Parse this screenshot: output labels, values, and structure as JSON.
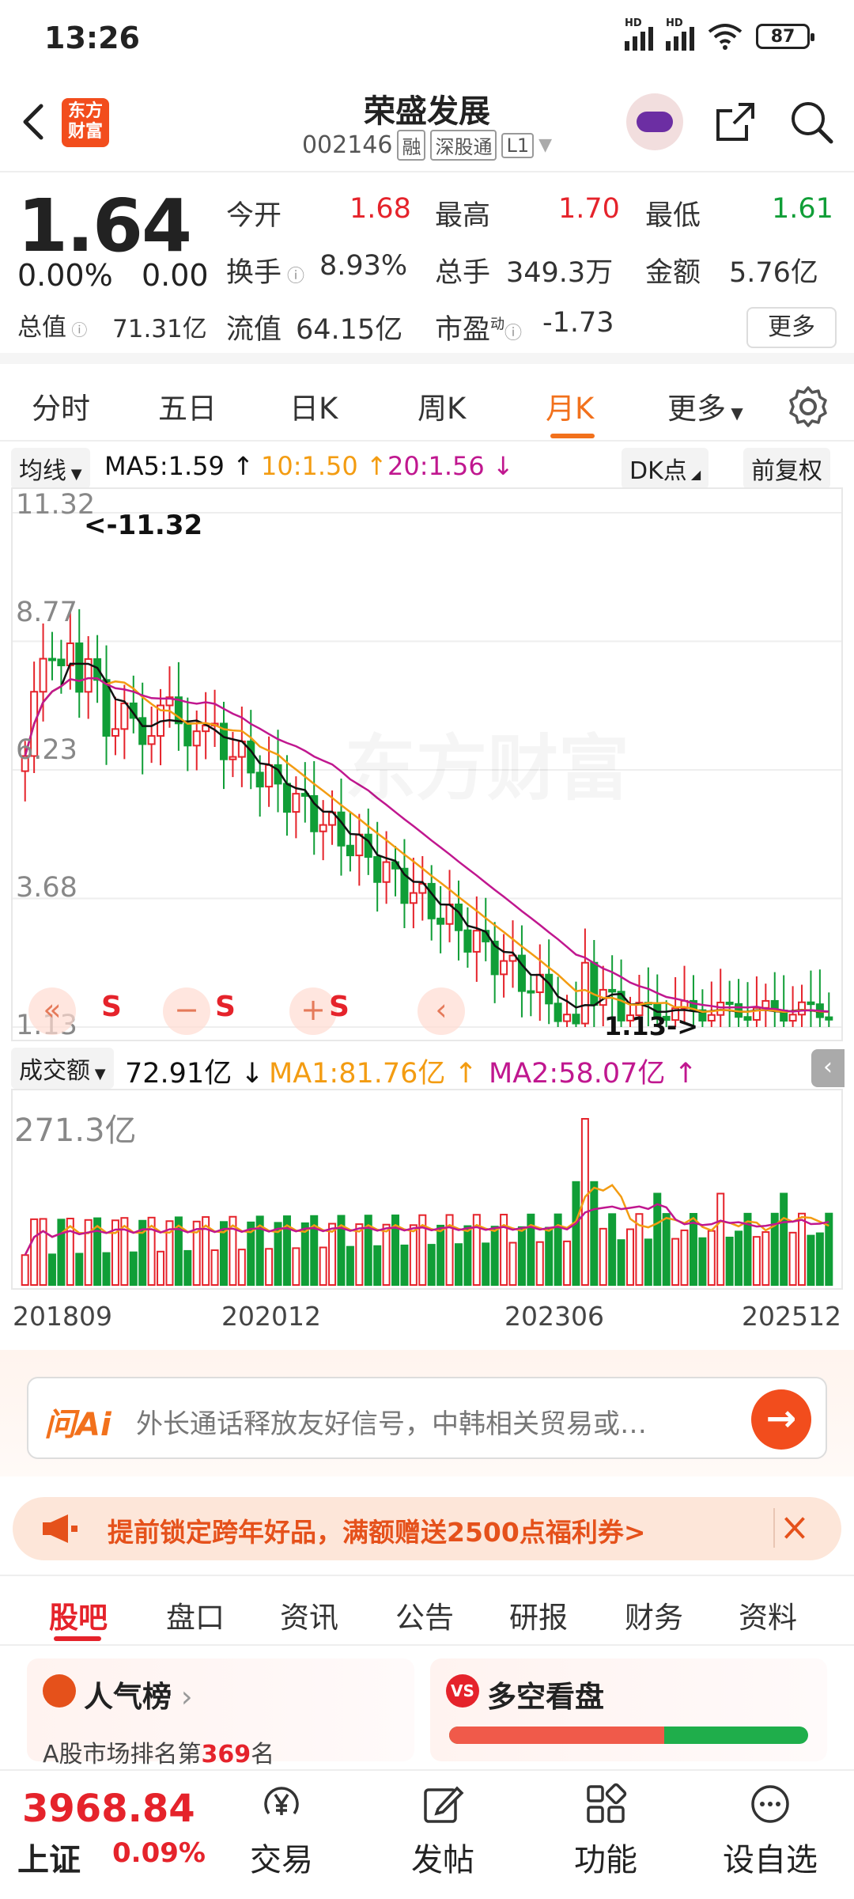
{
  "status_bar": {
    "time": "13:26",
    "battery": "87",
    "hd1": "HD",
    "hd2": "HD"
  },
  "header": {
    "logo_text": "东方财富",
    "stock_name": "荣盛发展",
    "stock_code": "002146",
    "tag_margin": "融",
    "tag_connect": "深股通",
    "tag_level": "L1"
  },
  "quote": {
    "price": "1.64",
    "change_pct": "0.00%",
    "change_amt": "0.00",
    "open_label": "今开",
    "open": "1.68",
    "high_label": "最高",
    "high": "1.70",
    "low_label": "最低",
    "low": "1.61",
    "turnover_label": "换手",
    "turnover": "8.93%",
    "volume_label": "总手",
    "volume": "349.3万",
    "amount_label": "金额",
    "amount": "5.76亿",
    "mktcap_label": "总值",
    "mktcap": "71.31亿",
    "float_label": "流值",
    "float": "64.15亿",
    "pe_label": "市盈",
    "pe_sup": "动",
    "pe": "-1.73",
    "more_label": "更多"
  },
  "period_tabs": [
    "分时",
    "五日",
    "日K",
    "周K",
    "月K",
    "更多"
  ],
  "active_period": "月K",
  "ma_bar": {
    "select_label": "均线",
    "ma5": "MA5:1.59",
    "ma10": "10:1.50",
    "ma20": "20:1.56",
    "dk_label": "DK点",
    "adjust_label": "前复权"
  },
  "colors": {
    "up": "#e5232b",
    "down": "#109e37",
    "ma5": "#111111",
    "ma10": "#f39c12",
    "ma20": "#c0178f",
    "accent": "#f2711c"
  },
  "chart_controls": [
    "«",
    "−",
    "+",
    "‹"
  ],
  "chart_s_marks": [
    "S",
    "S",
    "S"
  ],
  "watermark": "东方财富",
  "volume_bar": {
    "select_label": "成交额",
    "value": "72.91亿",
    "ma1": "MA1:81.76亿",
    "ma2": "MA2:58.07亿"
  },
  "chart_data": [
    {
      "type": "candlestick",
      "ylim": [
        1.13,
        11.32
      ],
      "y_ticks": [
        "11.32",
        "8.77",
        "6.23",
        "3.68",
        "1.13"
      ],
      "max_annotation": "<-11.32",
      "min_annotation": "1.13->",
      "series": [
        {
          "name": "MA5",
          "last": 1.59
        },
        {
          "name": "10",
          "last": 1.5
        },
        {
          "name": "20",
          "last": 1.56
        }
      ]
    },
    {
      "type": "bar",
      "ymax_label": "271.3亿",
      "x_labels": [
        "201809",
        "202012",
        "202306",
        "202512"
      ]
    }
  ],
  "ai": {
    "label": "问Ai",
    "text": "外长通话释放友好信号，中韩相关贸易或…"
  },
  "promo": {
    "text": "提前锁定跨年好品，满额赠送2500点福利券>"
  },
  "section_tabs": [
    "股吧",
    "盘口",
    "资讯",
    "公告",
    "研报",
    "财务",
    "资料"
  ],
  "active_section": "股吧",
  "cards": {
    "popularity_title": "人气榜",
    "popularity_sub_prefix": "A股市场排名第",
    "popularity_rank": "369",
    "popularity_sub_suffix": "名",
    "bullbear_title": "多空看盘",
    "bull_ratio": 0.6
  },
  "bottom_nav": {
    "index_value": "3968.84",
    "index_name": "上证",
    "index_change": "0.09%",
    "items": [
      "交易",
      "发帖",
      "功能",
      "设自选"
    ]
  }
}
